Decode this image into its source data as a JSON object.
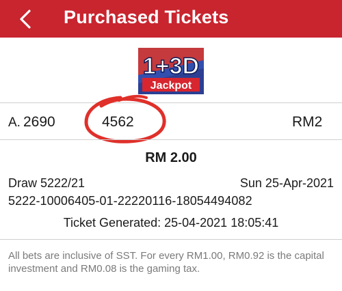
{
  "header": {
    "title": "Purchased Tickets",
    "back_icon": "chevron-left-icon",
    "color": "#c8252f"
  },
  "logo": {
    "main": "1+3D",
    "sub": "Jackpot"
  },
  "bet": {
    "letter": "A.",
    "number1": "2690",
    "number2": "4562",
    "amount": "RM2"
  },
  "ticket": {
    "total": "RM 2.00",
    "draw": "Draw 5222/21",
    "draw_date": "Sun 25-Apr-2021",
    "ticket_id": "5222-10006405-01-22220116-18054494082",
    "generated": "Ticket Generated: 25-04-2021 18:05:41"
  },
  "disclaimer": "All bets are inclusive of SST. For every RM1.00, RM0.92 is the capital investment and RM0.08 is the gaming tax."
}
